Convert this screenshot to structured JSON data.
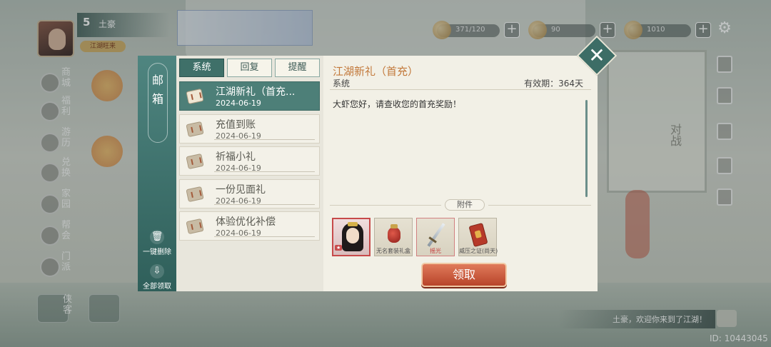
{
  "hud": {
    "player_level": "5",
    "player_name": "土豪",
    "player_title": "江湖旺来",
    "resources": [
      {
        "icon": "stamina-icon",
        "value": "371/120"
      },
      {
        "icon": "silver-icon",
        "value": "90"
      },
      {
        "icon": "gold-icon",
        "value": "1010"
      }
    ],
    "plus_label": "+"
  },
  "side_menu": {
    "items": [
      {
        "name": "shop",
        "label": "商城"
      },
      {
        "name": "welfare",
        "label": "福利"
      },
      {
        "name": "travel",
        "label": "游历"
      },
      {
        "name": "exchange",
        "label": "兑换"
      },
      {
        "name": "family",
        "label": "家园"
      },
      {
        "name": "guild",
        "label": "帮会"
      },
      {
        "name": "sect",
        "label": "门派"
      }
    ],
    "bottom_label": "侠客"
  },
  "background": {
    "screen_label": "对战"
  },
  "mail": {
    "panel_title": "邮箱",
    "tabs": [
      {
        "label": "系统",
        "active": true
      },
      {
        "label": "回复",
        "active": false
      },
      {
        "label": "提醒",
        "active": false
      }
    ],
    "items": [
      {
        "title": "江湖新礼（首充...",
        "date": "2024-06-19",
        "active": true
      },
      {
        "title": "充值到账",
        "date": "2024-06-19",
        "active": false
      },
      {
        "title": "祈福小礼",
        "date": "2024-06-19",
        "active": false
      },
      {
        "title": "一份见面礼",
        "date": "2024-06-19",
        "active": false
      },
      {
        "title": "体验优化补偿",
        "date": "2024-06-19",
        "active": false
      }
    ],
    "delete_all_label": "一键删除",
    "claim_all_label": "全部领取",
    "detail": {
      "heading": "江湖新礼（首充）",
      "sender": "系统",
      "validity": "有效期：364天",
      "body": "大虾您好，请查收您的首充奖励！",
      "attachments_label": "附件",
      "attachments": [
        {
          "label": "",
          "kind": "hero"
        },
        {
          "label": "无名套装礼盒",
          "kind": "bag"
        },
        {
          "label": "摇光",
          "kind": "sword"
        },
        {
          "label": "威压之证(尚天)",
          "kind": "token"
        }
      ],
      "claim_label": "领取"
    }
  },
  "chat": {
    "message": "土豪，欢迎你来到了江湖！"
  },
  "footer": {
    "id_text": "ID: 10443045"
  }
}
